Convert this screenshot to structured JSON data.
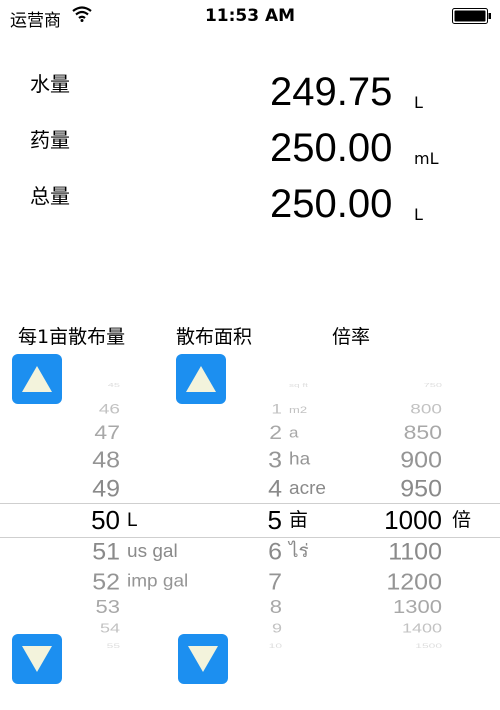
{
  "status": {
    "carrier": "运营商",
    "time": "11:53 AM"
  },
  "results": [
    {
      "label": "水量",
      "value": "249.75",
      "unit": "L"
    },
    {
      "label": "药量",
      "value": "250.00",
      "unit": "mL"
    },
    {
      "label": "总量",
      "value": "250.00",
      "unit": "L"
    }
  ],
  "headers": {
    "amount": "每1亩散布量",
    "area": "散布面积",
    "ratio": "倍率"
  },
  "picker": {
    "amount_values": [
      "45",
      "46",
      "47",
      "48",
      "49",
      "50",
      "51",
      "52",
      "53",
      "54",
      "55"
    ],
    "amount_units": [
      "L",
      "us gal",
      "imp gal"
    ],
    "area_values": [
      "1",
      "2",
      "3",
      "4",
      "5",
      "6",
      "7",
      "8",
      "9",
      "10"
    ],
    "area_units": [
      "sq ft",
      "m2",
      "a",
      "ha",
      "acre",
      "亩",
      "ไร่"
    ],
    "ratio_values": [
      "750",
      "800",
      "850",
      "900",
      "950",
      "1000",
      "1100",
      "1200",
      "1300",
      "1400",
      "1500"
    ],
    "ratio_unit": "倍"
  },
  "colors": {
    "accent": "#1c8ff0",
    "arrow": "#f3f3dc"
  },
  "icons": {
    "up": "triangle-up-icon",
    "down": "triangle-down-icon"
  }
}
